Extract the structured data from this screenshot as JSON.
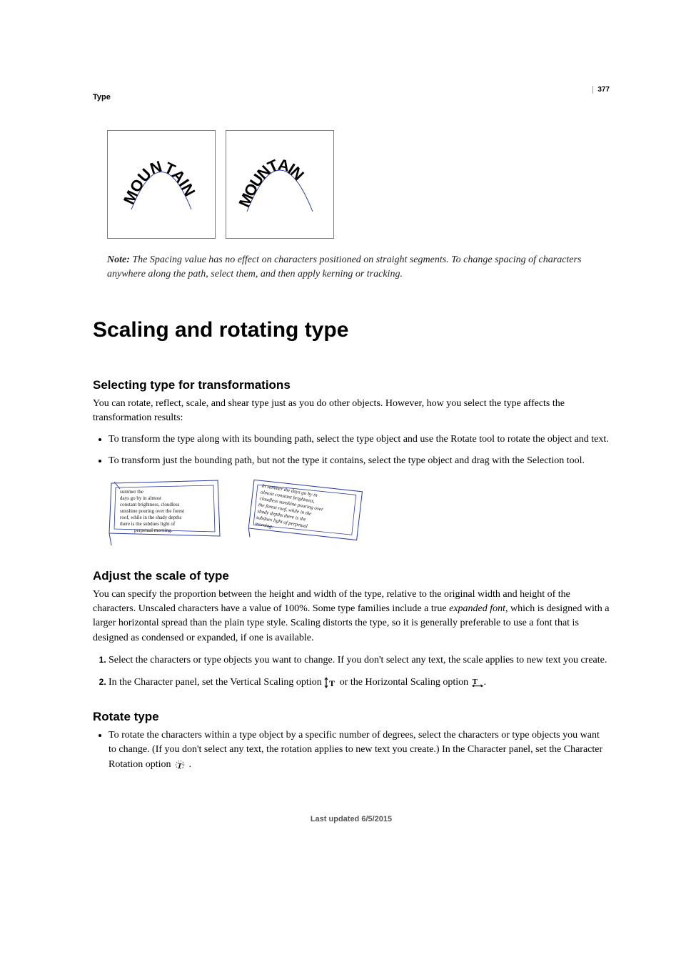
{
  "page_number": "377",
  "section_label": "Type",
  "note_prefix": "Note:",
  "note_text": " The Spacing value has no effect on characters positioned on straight segments. To change spacing of characters anywhere along the path, select them, and then apply kerning or tracking.",
  "h1": "Scaling and rotating type",
  "sec1": {
    "heading": "Selecting type for transformations",
    "para": "You can rotate, reflect, scale, and shear type just as you do other objects. However, how you select the type affects the transformation results:",
    "bullets": [
      "To transform the type along with its bounding path, select the type object and use the Rotate tool to rotate the object and text.",
      "To transform just the bounding path, but not the type it contains, select the type object and drag with the Selection tool."
    ]
  },
  "sec2": {
    "heading": "Adjust the scale of type",
    "para_parts": {
      "a": "You can specify the proportion between the height and width of the type, relative to the original width and height of the characters. Unscaled characters have a value of 100%. Some type families include a true ",
      "b": "expanded font",
      "c": ", which is designed with a larger horizontal spread than the plain type style. Scaling distorts the type, so it is generally preferable to use a font that is designed as condensed or expanded, if one is available."
    },
    "steps": {
      "s1": "Select the characters or type objects you want to change. If you don't select any text, the scale applies to new text you create.",
      "s2a": "In the Character panel, set the Vertical Scaling option ",
      "s2b": " or the Horizontal Scaling option ",
      "s2c": "."
    }
  },
  "sec3": {
    "heading": "Rotate type",
    "bullet_a": "To rotate the characters within a type object by a specific number of degrees, select the characters or type objects you want to change. (If you don't select any text, the rotation applies to new text you create.) In the Character panel, set the Character Rotation option ",
    "bullet_b": " ."
  },
  "figure": {
    "word": "MOUNTAIN",
    "thumb_lines": [
      "summer the",
      "days go by in almost",
      "constant brightness, cloudless",
      "sunshine pouring over the forest",
      "roof, while in the shady depths",
      "there is the subdues light of",
      "perpetual morning."
    ],
    "thumb2_lines": [
      "In summer the days go by in",
      "almost constant brightness,",
      "cloudless sunshine pouring over",
      "the forest roof, while in the",
      "shady depths there is the",
      "subdues light of perpetual",
      "morning."
    ]
  },
  "footer": "Last updated 6/5/2015"
}
